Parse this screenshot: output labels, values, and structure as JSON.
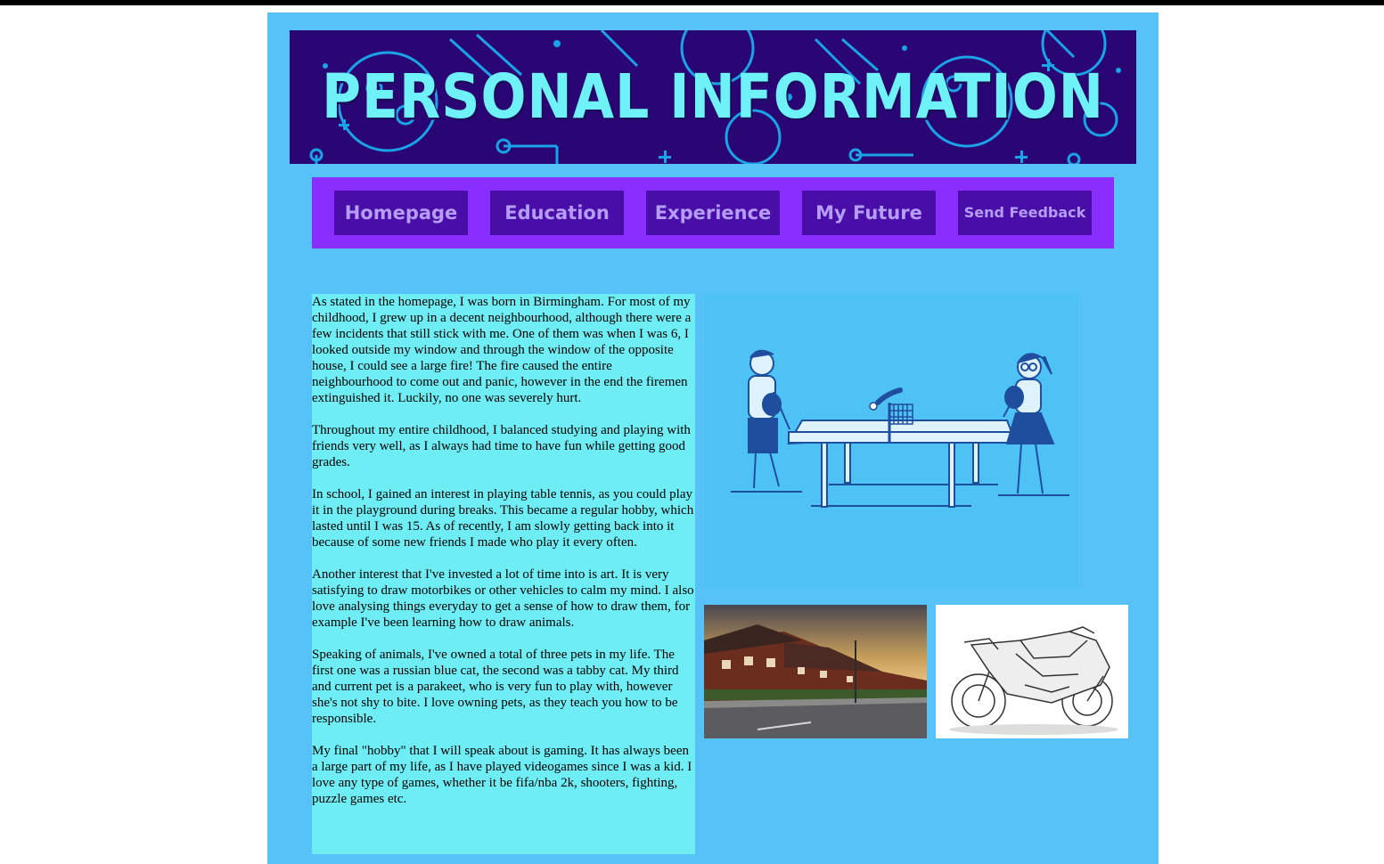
{
  "banner": {
    "title": "PERSONAL INFORMATION"
  },
  "nav": {
    "items": [
      {
        "label": "Homepage"
      },
      {
        "label": "Education"
      },
      {
        "label": "Experience"
      },
      {
        "label": "My Future"
      },
      {
        "label": "Send Feedback"
      }
    ]
  },
  "content": {
    "paragraphs": [
      "As stated in the homepage, I was born in Birmingham. For most of my childhood, I grew up in a decent neighbourhood, although there were a few incidents that still stick with me. One of them was when I was 6, I looked outside my window and through the window of the opposite house, I could see a large fire! The fire caused the entire neighbourhood to come out and panic, however in the end the firemen extinguished it. Luckily, no one was severely hurt.",
      "Throughout my entire childhood, I balanced studying and playing with friends very well, as I always had time to have fun while getting good grades.",
      "In school, I gained an interest in playing table tennis, as you could play it in the playground during breaks. This became a regular hobby, which lasted until I was 15. As of recently, I am slowly getting back into it because of some new friends I made who play it every often.",
      "Another interest that I've invested a lot of time into is art. It is very satisfying to draw motorbikes or other vehicles to calm my mind. I also love analysing things everyday to get a sense of how to draw them, for example I've been learning how to draw animals.",
      "Speaking of animals, I've owned a total of three pets in my life. The first one was a russian blue cat, the second was a tabby cat. My third and current pet is a parakeet, who is very fun to play with, however she's not shy to bite. I love owning pets, as they teach you how to be responsible.",
      "My final \"hobby\" that I will speak about is gaming. It has always been a large part of my life, as I have played videogames since I was a kid. I love any type of games, whether it be fifa/nba 2k, shooters, fighting, puzzle games etc."
    ]
  },
  "colors": {
    "page_bg": "#56c2f8",
    "banner_bg": "#2a0675",
    "banner_text": "#6ff2f7",
    "nav_bar": "#8a2eff",
    "nav_button": "#4a0ea8",
    "nav_text": "#b59cf7",
    "text_panel": "#6eedf4"
  }
}
